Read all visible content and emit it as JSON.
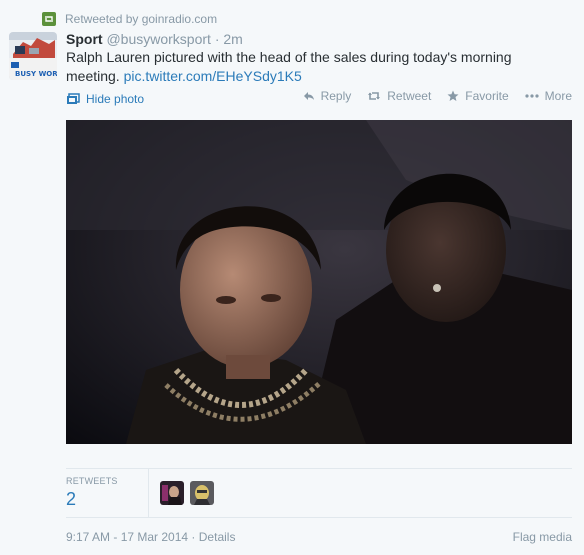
{
  "retweet": {
    "label": "Retweeted by goinradio.com",
    "icon": "retweet-icon"
  },
  "author": {
    "fullname": "Sport",
    "username": "@busyworksport",
    "separator": "·",
    "time": "2m",
    "avatar_text": "BUSY WORK"
  },
  "tweet": {
    "text": "Ralph Lauren pictured with the head of the sales during today's morning meeting.",
    "link": "pic.twitter.com/EHeYSdy1K5"
  },
  "media": {
    "hide_label": "Hide photo",
    "hide_icon": "photo-icon"
  },
  "actions": {
    "reply": "Reply",
    "retweet": "Retweet",
    "favorite": "Favorite",
    "more": "More"
  },
  "stats": {
    "retweets_label": "RETWEETS",
    "retweets_count": "2"
  },
  "footer": {
    "timestamp": "9:17 AM - 17 Mar 2014",
    "separator": "·",
    "details": "Details",
    "flag": "Flag media"
  },
  "colors": {
    "link": "#2b7bb9",
    "muted": "#8899a6",
    "retweet_green": "#5c913b",
    "background": "#f5f8fa"
  }
}
